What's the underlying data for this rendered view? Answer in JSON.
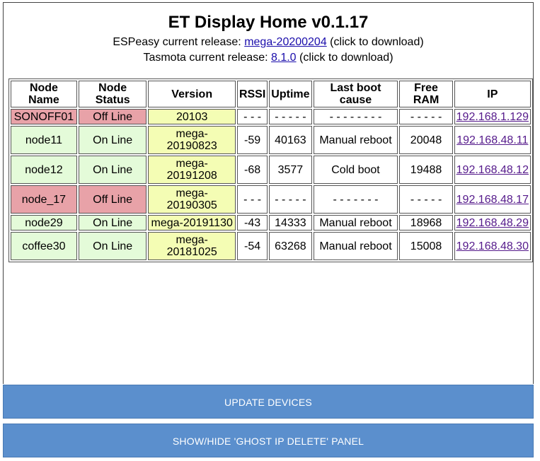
{
  "page": {
    "title": "ET Display Home v0.1.17",
    "espeasy": {
      "prefix": "ESPeasy current release: ",
      "link": "mega-20200204",
      "suffix": " (click to download)"
    },
    "tasmota": {
      "prefix": "Tasmota current release: ",
      "link": "8.1.0",
      "suffix": " (click to download)"
    }
  },
  "colors": {
    "offline": "#e8a2a8",
    "online": "#e4fbd9",
    "version": "#f4fdb4",
    "button": "#5b8fcd"
  },
  "table": {
    "headers": {
      "name": [
        "Node",
        "Name"
      ],
      "status": [
        "Node",
        "Status"
      ],
      "version": "Version",
      "rssi": "RSSI",
      "uptime": "Uptime",
      "boot": [
        "Last boot",
        "cause"
      ],
      "ram": [
        "Free",
        "RAM"
      ],
      "ip": "IP"
    },
    "rows": [
      {
        "name": "SONOFF01",
        "status": "Off Line",
        "version": [
          "20103"
        ],
        "rssi": "- - -",
        "uptime": "- - - - -",
        "boot": "- - - - - - - -",
        "ram": "- - - - -",
        "ip": "192.168.1.129"
      },
      {
        "name": "node11",
        "status": "On Line",
        "version": [
          "mega-",
          "20190823"
        ],
        "rssi": "-59",
        "uptime": "40163",
        "boot": "Manual reboot",
        "ram": "20048",
        "ip": "192.168.48.11"
      },
      {
        "name": "node12",
        "status": "On Line",
        "version": [
          "mega-",
          "20191208"
        ],
        "rssi": "-68",
        "uptime": "3577",
        "boot": "Cold boot",
        "ram": "19488",
        "ip": "192.168.48.12"
      },
      {
        "name": "node_17",
        "status": "Off Line",
        "version": [
          "mega-",
          "20190305"
        ],
        "rssi": "- - -",
        "uptime": "- - - - -",
        "boot": "- - - - - - -",
        "ram": "- - - - -",
        "ip": "192.168.48.17"
      },
      {
        "name": "node29",
        "status": "On Line",
        "version": [
          "mega-20191130"
        ],
        "rssi": "-43",
        "uptime": "14333",
        "boot": "Manual reboot",
        "ram": "18968",
        "ip": "192.168.48.29"
      },
      {
        "name": "coffee30",
        "status": "On Line",
        "version": [
          "mega-",
          "20181025"
        ],
        "rssi": "-54",
        "uptime": "63268",
        "boot": "Manual reboot",
        "ram": "15008",
        "ip": "192.168.48.30"
      }
    ]
  },
  "buttons": {
    "update": "UPDATE DEVICES",
    "ghost": "SHOW/HIDE 'GHOST IP DELETE' PANEL"
  }
}
